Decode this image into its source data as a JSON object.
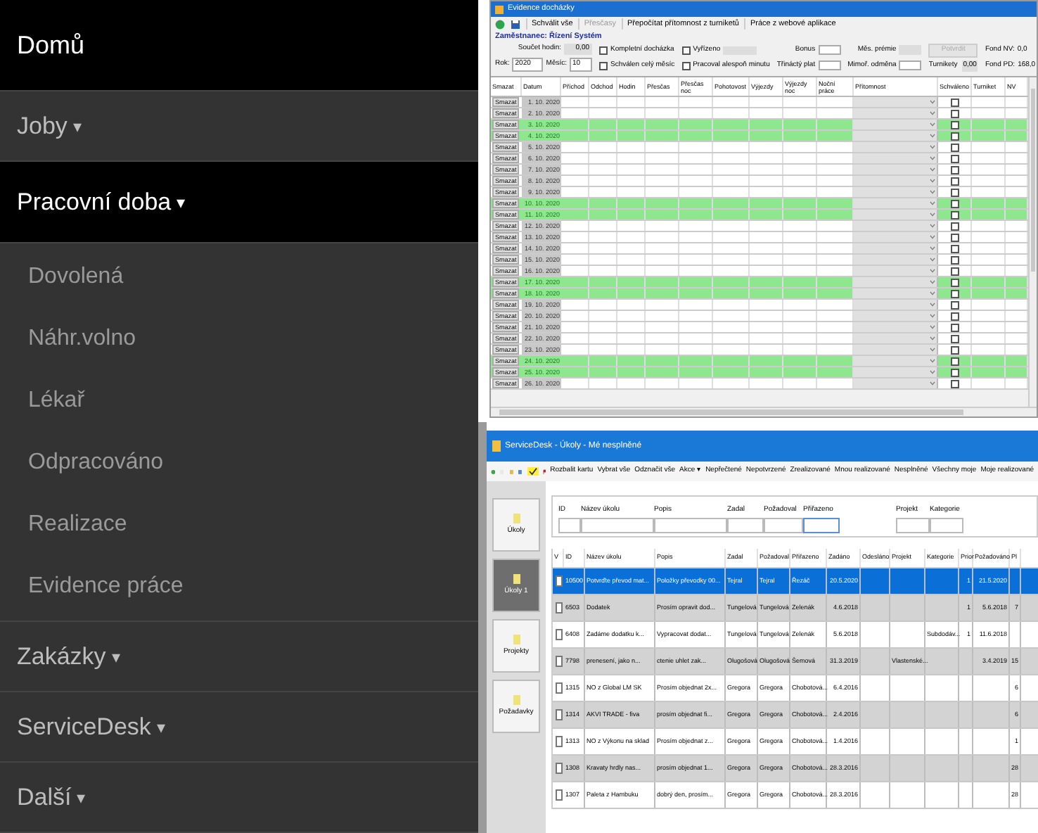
{
  "sidebar": {
    "home": "Domů",
    "items": [
      {
        "label": "Joby",
        "caret": "▾",
        "selected": false
      },
      {
        "label": "Pracovní doba",
        "caret": "▾",
        "selected": true,
        "children": [
          {
            "label": "Dovolená"
          },
          {
            "label": "Náhr.volno"
          },
          {
            "label": "Lékař"
          },
          {
            "label": "Odpracováno"
          },
          {
            "label": "Realizace"
          },
          {
            "label": "Evidence práce"
          }
        ]
      },
      {
        "label": "Zakázky",
        "caret": "▾",
        "selected": false
      },
      {
        "label": "ServiceDesk",
        "caret": "▾",
        "selected": false
      },
      {
        "label": "Další",
        "caret": "▾",
        "selected": false
      }
    ]
  },
  "attendance_window": {
    "title": "Evidence docházky",
    "toolbar": [
      {
        "label": "Schválit vše",
        "disabled": false
      },
      {
        "label": "Přesčasy",
        "disabled": true
      },
      {
        "label": "Přepočítat přítomnost z turniketů",
        "disabled": false
      },
      {
        "label": "Práce z webové aplikace",
        "disabled": false
      }
    ],
    "employee": "Zaměstnanec: Řízení Systém",
    "sum_hours": {
      "label": "Součet hodin:",
      "value": "0,00"
    },
    "year": {
      "label": "Rok:",
      "value": "2020"
    },
    "month": {
      "label": "Měsíc:",
      "value": "10"
    },
    "checkboxes": [
      {
        "label": "Kompletní docházka",
        "checked": false
      },
      {
        "label": "Schválen celý měsíc",
        "checked": false
      },
      {
        "label": "Vyřízeno",
        "checked": false
      },
      {
        "label": "Pracoval alespoň minutu",
        "checked": false
      }
    ],
    "fields": [
      {
        "label": "Bonus",
        "disabled": false
      },
      {
        "label": "Třináctý plat",
        "disabled": false
      },
      {
        "label": "Měs. prémie",
        "disabled": true
      },
      {
        "label": "Mimoř. odměna",
        "disabled": false
      }
    ],
    "confirm_button": {
      "label": "Potvrdit",
      "disabled": true
    },
    "totals": [
      {
        "label": "Turnikety",
        "value": "0,00"
      },
      {
        "label": "Fond NV:",
        "value": "0,0"
      },
      {
        "label": "Fond PD:",
        "value": "168,0"
      }
    ],
    "columns": [
      "Smazat",
      "Datum",
      "Příchod",
      "Odchod",
      "Hodin",
      "Přesčas",
      "Přesčas noc",
      "Pohotovost",
      "Výjezdy",
      "Výjezdy noc",
      "Noční práce",
      "Přítomnost",
      "Schváleno",
      "Turniket",
      "NV"
    ],
    "rows": [
      {
        "delete": "Smazat",
        "date": "1. 10. 2020",
        "highlighted": false,
        "approved": false
      },
      {
        "delete": "Smazat",
        "date": "2. 10. 2020",
        "highlighted": false,
        "approved": false
      },
      {
        "delete": "Smazat",
        "date": "3. 10. 2020",
        "highlighted": true,
        "approved": false
      },
      {
        "delete": "Smazat",
        "date": "4. 10. 2020",
        "highlighted": true,
        "approved": false
      },
      {
        "delete": "Smazat",
        "date": "5. 10. 2020",
        "highlighted": false,
        "approved": false
      },
      {
        "delete": "Smazat",
        "date": "6. 10. 2020",
        "highlighted": false,
        "approved": false
      },
      {
        "delete": "Smazat",
        "date": "7. 10. 2020",
        "highlighted": false,
        "approved": false
      },
      {
        "delete": "Smazat",
        "date": "8. 10. 2020",
        "highlighted": false,
        "approved": false
      },
      {
        "delete": "Smazat",
        "date": "9. 10. 2020",
        "highlighted": false,
        "approved": false
      },
      {
        "delete": "Smazat",
        "date": "10. 10. 2020",
        "highlighted": true,
        "approved": false
      },
      {
        "delete": "Smazat",
        "date": "11. 10. 2020",
        "highlighted": true,
        "approved": false
      },
      {
        "delete": "Smazat",
        "date": "12. 10. 2020",
        "highlighted": false,
        "approved": false
      },
      {
        "delete": "Smazat",
        "date": "13. 10. 2020",
        "highlighted": false,
        "approved": false
      },
      {
        "delete": "Smazat",
        "date": "14. 10. 2020",
        "highlighted": false,
        "approved": false
      },
      {
        "delete": "Smazat",
        "date": "15. 10. 2020",
        "highlighted": false,
        "approved": false
      },
      {
        "delete": "Smazat",
        "date": "16. 10. 2020",
        "highlighted": false,
        "approved": false
      },
      {
        "delete": "Smazat",
        "date": "17. 10. 2020",
        "highlighted": true,
        "approved": false
      },
      {
        "delete": "Smazat",
        "date": "18. 10. 2020",
        "highlighted": true,
        "approved": false
      },
      {
        "delete": "Smazat",
        "date": "19. 10. 2020",
        "highlighted": false,
        "approved": false
      },
      {
        "delete": "Smazat",
        "date": "20. 10. 2020",
        "highlighted": false,
        "approved": false
      },
      {
        "delete": "Smazat",
        "date": "21. 10. 2020",
        "highlighted": false,
        "approved": false
      },
      {
        "delete": "Smazat",
        "date": "22. 10. 2020",
        "highlighted": false,
        "approved": false
      },
      {
        "delete": "Smazat",
        "date": "23. 10. 2020",
        "highlighted": false,
        "approved": false
      },
      {
        "delete": "Smazat",
        "date": "24. 10. 2020",
        "highlighted": true,
        "approved": false
      },
      {
        "delete": "Smazat",
        "date": "25. 10. 2020",
        "highlighted": true,
        "approved": false
      },
      {
        "delete": "Smazat",
        "date": "26. 10. 2020",
        "highlighted": false,
        "approved": false
      }
    ]
  },
  "tasks_window": {
    "title": "ServiceDesk - Úkoly - Mé nesplněné",
    "toolbar": [
      "Rozbalit kartu",
      "Vybrat vše",
      "Odznačit vše",
      "Akce ▾",
      "Nepřečtené",
      "Nepotvrzené",
      "Zrealizované",
      "Mnou realizované",
      "Nesplněné",
      "Všechny moje",
      "Moje realizované"
    ],
    "nav": [
      {
        "label": "Úkoly",
        "selected": false
      },
      {
        "label": "Úkoly 1",
        "selected": true
      },
      {
        "label": "Projekty",
        "selected": false
      },
      {
        "label": "Požadavky",
        "selected": false
      }
    ],
    "filters": [
      "ID",
      "Název úkolu",
      "Popis",
      "Zadal",
      "Požadoval",
      "Přiřazeno",
      "Projekt",
      "Kategorie"
    ],
    "columns": [
      "V",
      "ID",
      "Název úkolu",
      "Popis",
      "Zadal",
      "Požadoval",
      "Přiřazeno",
      "Zadáno",
      "Odesláno",
      "Projekt",
      "Kategorie",
      "Prior",
      "Požadováno",
      "Pl"
    ],
    "rows": [
      {
        "selected": true,
        "checked": false,
        "cells": [
          "",
          "10500",
          "Potvrďte převod mat...",
          "Položky převodky 00...",
          "Tejral",
          "Tejral",
          "Řezáč",
          "20.5.2020",
          "",
          "",
          "",
          "1",
          "21.5.2020",
          ""
        ]
      },
      {
        "selected": false,
        "checked": false,
        "cells": [
          "",
          "6503",
          "Dodatek",
          "Prosím opravit dod...",
          "Tungelová",
          "Tungelová",
          "Zelenák",
          "4.6.2018",
          "",
          "",
          "",
          "1",
          "5.6.2018",
          "7"
        ]
      },
      {
        "selected": false,
        "checked": false,
        "cells": [
          "",
          "6408",
          "Zadáme dodatku k...",
          "Vypracovat dodat...",
          "Tungelová",
          "Tungelová",
          "Zelenák",
          "5.6.2018",
          "",
          "",
          "Subdodáv...",
          "1",
          "11.6.2018",
          ""
        ]
      },
      {
        "selected": false,
        "checked": false,
        "cells": [
          "",
          "7798",
          "prenesení, jako n...",
          "ctenie uhlet zak...",
          "Olugošová",
          "Olugošová",
          "Šemová",
          "31.3.2019",
          "",
          "Vlastenské...",
          "",
          "",
          "3.4.2019",
          "15"
        ]
      },
      {
        "selected": false,
        "checked": false,
        "cells": [
          "",
          "1315",
          "NO z Global LM SK",
          "Prosím objednat 2x...",
          "Gregora",
          "Gregora",
          "Chobotová...",
          "6.4.2016",
          "",
          "",
          "",
          "",
          "",
          "6"
        ]
      },
      {
        "selected": false,
        "checked": false,
        "cells": [
          "",
          "1314",
          "AKVI TRADE - fiva",
          "prosím objednat fi...",
          "Gregora",
          "Gregora",
          "Chobotová...",
          "2.4.2016",
          "",
          "",
          "",
          "",
          "",
          "6"
        ]
      },
      {
        "selected": false,
        "checked": false,
        "cells": [
          "",
          "1313",
          "NO z Výkonu na sklad",
          "Prosím objednat z...",
          "Gregora",
          "Gregora",
          "Chobotová...",
          "1.4.2016",
          "",
          "",
          "",
          "",
          "",
          "1"
        ]
      },
      {
        "selected": false,
        "checked": false,
        "cells": [
          "",
          "1308",
          "Kravaty hrdly nas...",
          "prosím objednat 1...",
          "Gregora",
          "Gregora",
          "Chobotová...",
          "28.3.2016",
          "",
          "",
          "",
          "",
          "",
          "28"
        ]
      },
      {
        "selected": false,
        "checked": false,
        "cells": [
          "",
          "1307",
          "Paleta z Hambuku",
          "dobrý den, prosím...",
          "Gregora",
          "Gregora",
          "Chobotová...",
          "28.3.2016",
          "",
          "",
          "",
          "",
          "",
          "28"
        ]
      }
    ]
  }
}
